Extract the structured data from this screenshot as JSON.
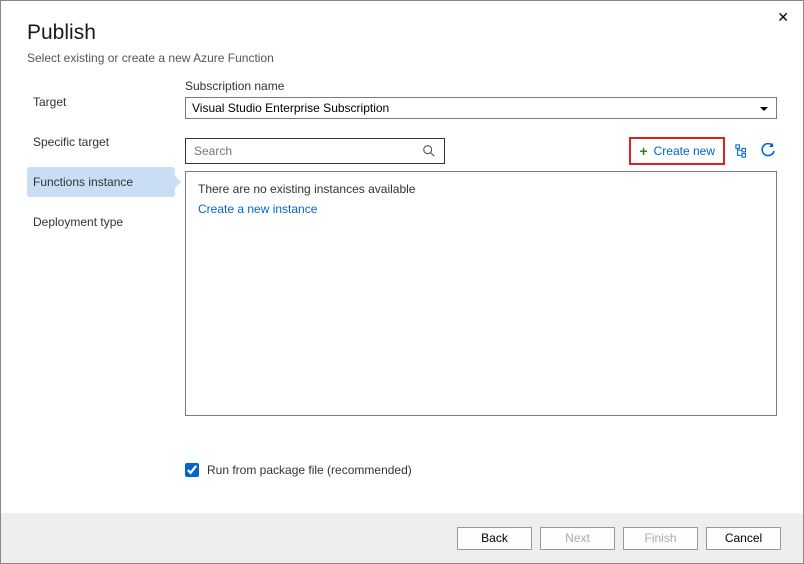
{
  "header": {
    "title": "Publish",
    "subtitle": "Select existing or create a new Azure Function"
  },
  "sidebar": {
    "items": [
      {
        "label": "Target"
      },
      {
        "label": "Specific target"
      },
      {
        "label": "Functions instance"
      },
      {
        "label": "Deployment type"
      }
    ],
    "selected_index": 2
  },
  "main": {
    "subscription_label": "Subscription name",
    "subscription_value": "Visual Studio Enterprise Subscription",
    "search_placeholder": "Search",
    "create_new_label": "Create new",
    "results_empty_msg": "There are no existing instances available",
    "create_instance_link": "Create a new instance"
  },
  "checkbox": {
    "checked": true,
    "label": "Run from package file (recommended)"
  },
  "footer": {
    "back": "Back",
    "next": "Next",
    "finish": "Finish",
    "cancel": "Cancel"
  }
}
